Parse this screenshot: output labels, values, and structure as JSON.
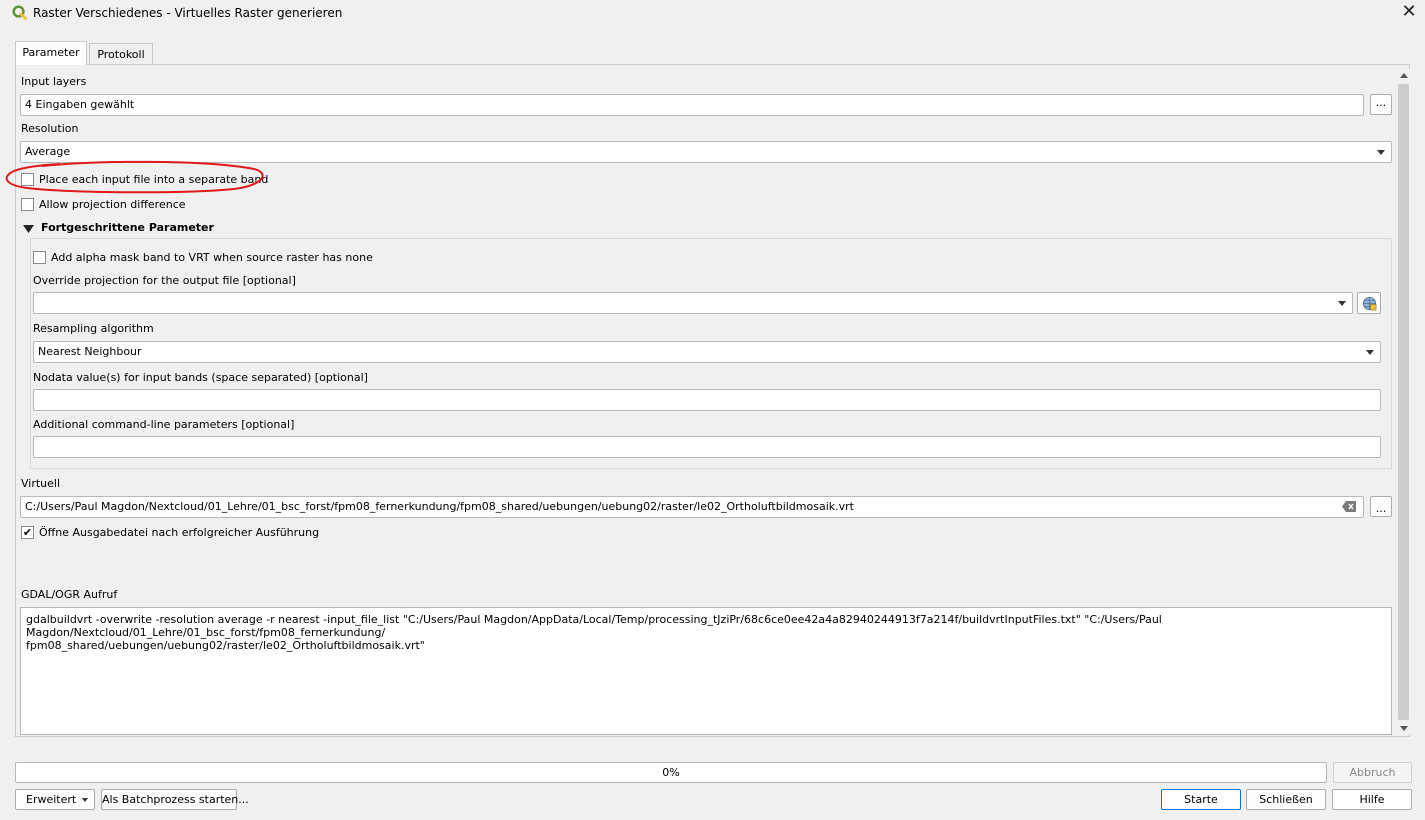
{
  "window": {
    "title": "Raster Verschiedenes - Virtuelles Raster generieren",
    "close_label": "✕"
  },
  "tabs": [
    {
      "label": "Parameter",
      "active": true
    },
    {
      "label": "Protokoll",
      "active": false
    }
  ],
  "params": {
    "input_layers_label": "Input layers",
    "input_layers_value": "4 Eingaben gewählt",
    "browse_label": "...",
    "resolution_label": "Resolution",
    "resolution_value": "Average",
    "separate_band_label": "Place each input file into a separate band",
    "separate_band_checked": false,
    "allow_projection_label": "Allow projection difference",
    "allow_projection_checked": false
  },
  "advanced": {
    "header": "Fortgeschrittene Parameter",
    "alpha_mask_label": "Add alpha mask band to VRT when source raster has none",
    "alpha_mask_checked": false,
    "override_projection_label": "Override projection for the output file [optional]",
    "override_projection_value": "",
    "resampling_label": "Resampling algorithm",
    "resampling_value": "Nearest Neighbour",
    "nodata_label": "Nodata value(s) for input bands (space separated) [optional]",
    "nodata_value": "",
    "extra_label": "Additional command-line parameters [optional]",
    "extra_value": ""
  },
  "output": {
    "label": "Virtuell",
    "path": "C:/Users/Paul Magdon/Nextcloud/01_Lehre/01_bsc_forst/fpm08_fernerkundung/fpm08_shared/uebungen/uebung02/raster/le02_Ortholuftbildmosaik.vrt",
    "browse_label": "...",
    "open_after_label": "Öffne Ausgabedatei nach erfolgreicher Ausführung",
    "open_after_checked": true,
    "check_glyph": "✔"
  },
  "console": {
    "label": "GDAL/OGR Aufruf",
    "command": "gdalbuildvrt -overwrite -resolution average -r nearest -input_file_list \"C:/Users/Paul Magdon/AppData/Local/Temp/processing_tJziPr/68c6ce0ee42a4a82940244913f7a214f/buildvrtInputFiles.txt\" \"C:/Users/Paul Magdon/Nextcloud/01_Lehre/01_bsc_forst/fpm08_fernerkundung/\nfpm08_shared/uebungen/uebung02/raster/le02_Ortholuftbildmosaik.vrt\""
  },
  "footer": {
    "progress_text": "0%",
    "progress_value": 0,
    "cancel_label": "Abbruch",
    "advanced_label": "Erweitert",
    "batch_label": "Als Batchprozess starten...",
    "run_label": "Starte",
    "close_label": "Schließen",
    "help_label": "Hilfe"
  },
  "colors": {
    "accent": "#0078d7",
    "annotation": "#e0191b",
    "qgis_green": "#589632",
    "qgis_yellow": "#f0c23a"
  }
}
